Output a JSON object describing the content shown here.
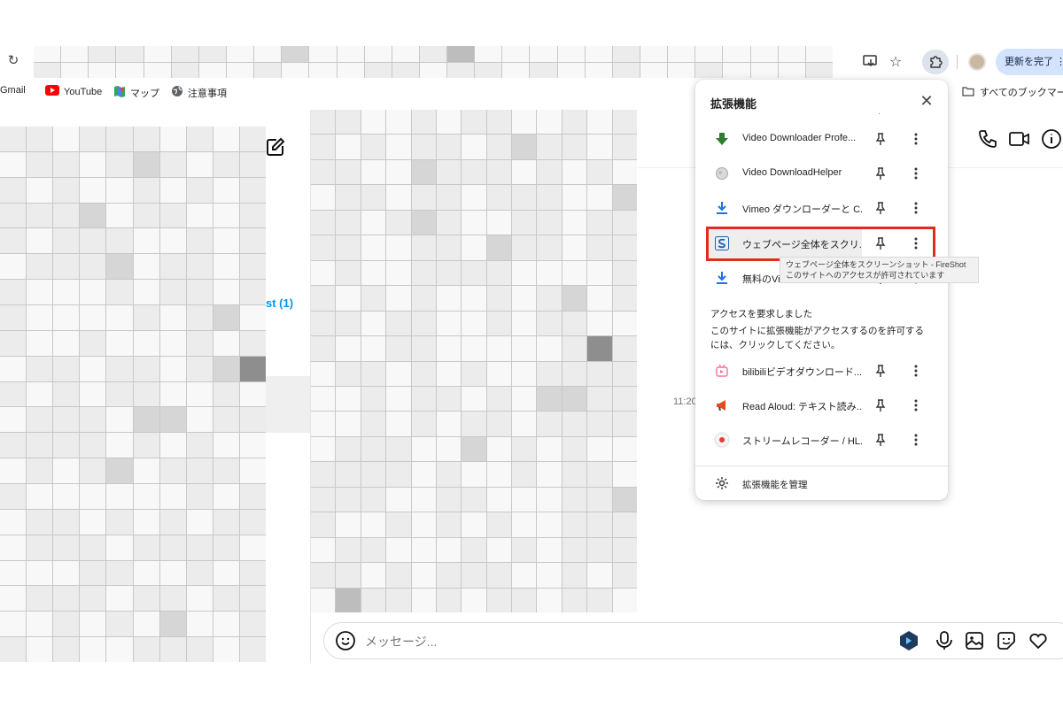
{
  "browser": {
    "update_label": "更新を完了"
  },
  "bookmarks": {
    "items": [
      {
        "label": "Gmail",
        "icon": "gmail-icon"
      },
      {
        "label": "YouTube",
        "icon": "youtube-icon"
      },
      {
        "label": "マップ",
        "icon": "maps-icon"
      },
      {
        "label": "注意事項",
        "icon": "globe-icon"
      }
    ],
    "all_bookmarks": "すべてのブックマーク"
  },
  "chat": {
    "link_fragment": "st (1)",
    "time_fragment": "11:20",
    "message_placeholder": "メッセージ..."
  },
  "extensions_panel": {
    "title": "拡張機能",
    "items": [
      {
        "name": "Video Downloader Profe...",
        "icon": "green-download-icon"
      },
      {
        "name": "Video DownloadHelper",
        "icon": "downloadhelper-icon"
      },
      {
        "name": "Vimeo ダウンローダーと C...",
        "icon": "blue-download-icon"
      },
      {
        "name": "ウェブページ全体をスクリ...",
        "icon": "fireshot-icon"
      },
      {
        "name": "無料のVime",
        "icon": "blue-download-icon"
      }
    ],
    "tooltip_line1": "ウェブページ全体をスクリーンショット - FireShot",
    "tooltip_line2": "このサイトへのアクセスが許可されています",
    "access_heading": "アクセスを要求しました",
    "access_text": "このサイトに拡張機能がアクセスするのを許可するには、クリックしてください。",
    "access_items": [
      {
        "name": "bilibiliビデオダウンロード...",
        "icon": "bilibili-icon"
      },
      {
        "name": "Read Aloud: テキスト読み...",
        "icon": "megaphone-icon"
      },
      {
        "name": "ストリームレコーダー / HL...",
        "icon": "record-icon"
      }
    ],
    "manage_label": "拡張機能を管理"
  },
  "colors": {
    "highlight": "#e02b1f",
    "link": "#0095f6",
    "update_button": "#d3e3fd"
  },
  "mosaic": {
    "address_bar": [
      0,
      0,
      1,
      1,
      0,
      1,
      1,
      0,
      0,
      2,
      0,
      0,
      0,
      0,
      1,
      3,
      0,
      0,
      0,
      0,
      0,
      1,
      0,
      0,
      0,
      0,
      0,
      0,
      0,
      1,
      0,
      0,
      0,
      0,
      1,
      0,
      0,
      1,
      0,
      0,
      0,
      1,
      1,
      0,
      1,
      1,
      0,
      1,
      0,
      0,
      1,
      0,
      0,
      1,
      0,
      0,
      0,
      1
    ],
    "left": [
      1,
      1,
      0,
      1,
      1,
      1,
      0,
      1,
      0,
      1,
      0,
      1,
      1,
      0,
      1,
      2,
      1,
      0,
      1,
      1,
      1,
      0,
      1,
      0,
      0,
      1,
      0,
      1,
      0,
      1,
      1,
      1,
      1,
      2,
      0,
      1,
      1,
      0,
      0,
      1,
      1,
      0,
      1,
      1,
      1,
      0,
      0,
      1,
      0,
      1,
      0,
      1,
      1,
      1,
      2,
      0,
      1,
      1,
      0,
      1,
      1,
      0,
      0,
      0,
      1,
      0,
      1,
      1,
      0,
      1,
      1,
      0,
      0,
      0,
      0,
      1,
      0,
      1,
      2,
      0,
      1,
      0,
      0,
      1,
      0,
      0,
      0,
      1,
      0,
      1,
      0,
      1,
      1,
      0,
      1,
      1,
      0,
      1,
      2,
      4,
      1,
      0,
      1,
      0,
      1,
      1,
      0,
      0,
      1,
      0,
      0,
      1,
      1,
      1,
      0,
      2,
      2,
      0,
      1,
      1,
      1,
      1,
      1,
      1,
      0,
      1,
      0,
      1,
      0,
      0,
      0,
      1,
      0,
      1,
      2,
      0,
      1,
      1,
      1,
      0,
      1,
      0,
      0,
      0,
      0,
      0,
      0,
      1,
      0,
      1,
      0,
      1,
      1,
      0,
      1,
      0,
      1,
      0,
      1,
      1,
      0,
      1,
      1,
      1,
      0,
      1,
      1,
      1,
      1,
      0,
      0,
      0,
      0,
      1,
      1,
      0,
      0,
      1,
      0,
      1,
      0,
      1,
      1,
      1,
      0,
      1,
      1,
      0,
      1,
      1,
      0,
      0,
      1,
      0,
      1,
      0,
      2,
      0,
      0,
      1,
      1,
      0,
      1,
      0,
      0,
      1,
      1,
      1,
      0,
      1,
      1,
      3,
      1,
      0,
      1,
      0,
      1,
      1,
      0,
      1
    ],
    "center": [
      1,
      1,
      0,
      0,
      1,
      0,
      1,
      1,
      0,
      0,
      1,
      0,
      1,
      1,
      0,
      1,
      0,
      1,
      1,
      0,
      1,
      2,
      1,
      1,
      0,
      1,
      1,
      1,
      0,
      0,
      2,
      1,
      1,
      1,
      0,
      1,
      0,
      1,
      0,
      0,
      1,
      1,
      0,
      1,
      1,
      0,
      1,
      1,
      1,
      0,
      0,
      2,
      1,
      1,
      0,
      1,
      2,
      1,
      0,
      0,
      1,
      1,
      0,
      1,
      1,
      1,
      1,
      0,
      0,
      1,
      1,
      0,
      2,
      1,
      1,
      0,
      1,
      1,
      0,
      1,
      0,
      0,
      1,
      1,
      1,
      1,
      0,
      0,
      0,
      0,
      1,
      1,
      0,
      1,
      0,
      1,
      0,
      0,
      1,
      0,
      1,
      2,
      0,
      1,
      1,
      1,
      0,
      1,
      1,
      0,
      0,
      1,
      0,
      1,
      1,
      0,
      0,
      1,
      0,
      0,
      1,
      1,
      0,
      0,
      0,
      0,
      0,
      1,
      4,
      1,
      0,
      1,
      1,
      0,
      1,
      0,
      1,
      0,
      0,
      1,
      1,
      1,
      1,
      0,
      0,
      1,
      0,
      1,
      1,
      0,
      1,
      0,
      2,
      2,
      1,
      1,
      0,
      0,
      1,
      0,
      1,
      0,
      1,
      1,
      0,
      1,
      1,
      1,
      1,
      0,
      1,
      1,
      1,
      0,
      0,
      2,
      0,
      1,
      0,
      1,
      0,
      0,
      1,
      1,
      1,
      1,
      0,
      1,
      0,
      0,
      1,
      0,
      1,
      1,
      0,
      1,
      1,
      1,
      0,
      0,
      1,
      1,
      0,
      0,
      0,
      1,
      1,
      2,
      1,
      0,
      0,
      1,
      0,
      1,
      0,
      1,
      0,
      0,
      1,
      1,
      1,
      0,
      1,
      1,
      0,
      0,
      0,
      1,
      0,
      1,
      0,
      1,
      1,
      1,
      1,
      1,
      0,
      1,
      0,
      1,
      1,
      1,
      0,
      0,
      1,
      0,
      1,
      0,
      3,
      1,
      1,
      0,
      1,
      0,
      1,
      1,
      0,
      1,
      1,
      0,
      2,
      1,
      1,
      1,
      1,
      0,
      1
    ]
  }
}
